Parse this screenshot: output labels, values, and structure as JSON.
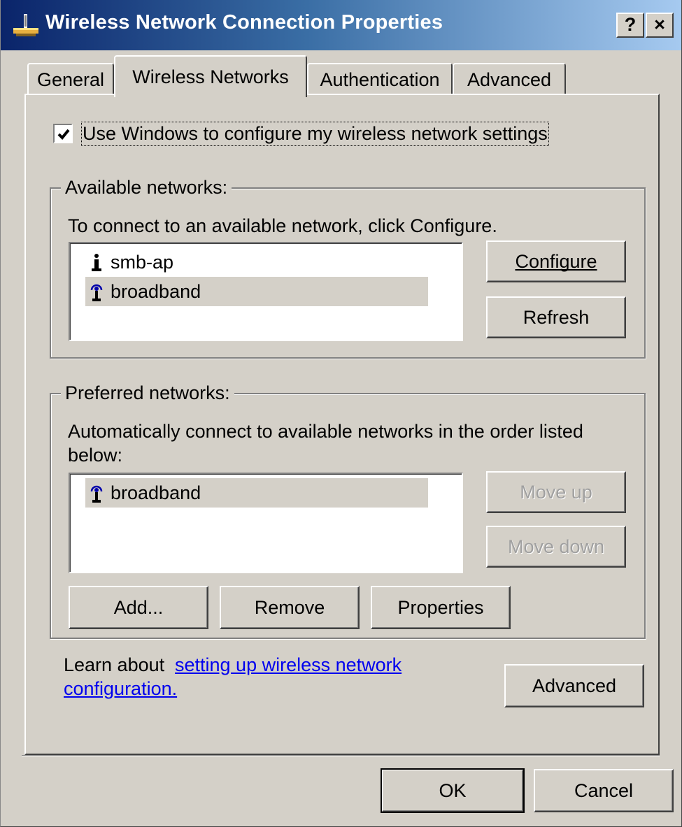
{
  "window": {
    "title": "Wireless Network Connection Properties",
    "help_label": "?",
    "close_label": "×"
  },
  "tabs": [
    {
      "label": "General",
      "active": false
    },
    {
      "label": "Wireless Networks",
      "active": true
    },
    {
      "label": "Authentication",
      "active": false
    },
    {
      "label": "Advanced",
      "active": false
    }
  ],
  "use_windows": {
    "label": "Use Windows to configure my wireless network settings",
    "checked": true
  },
  "available": {
    "legend": "Available networks:",
    "description": "To connect to an available network, click Configure.",
    "networks": [
      {
        "name": "smb-ap",
        "icon": "access-point-icon"
      },
      {
        "name": "broadband",
        "icon": "wireless-antenna-icon"
      }
    ],
    "configure_label": "Configure",
    "refresh_label": "Refresh"
  },
  "preferred": {
    "legend": "Preferred networks:",
    "description_line1": "Automatically connect to available networks in the order listed",
    "description_line2": "below:",
    "networks": [
      {
        "name": "broadband",
        "icon": "wireless-antenna-icon"
      }
    ],
    "move_up_label": "Move up",
    "move_down_label": "Move down",
    "add_label": "Add...",
    "remove_label": "Remove",
    "properties_label": "Properties"
  },
  "learn": {
    "prefix": "Learn about",
    "link_line1": "setting up wireless network",
    "link_line2": "configuration."
  },
  "advanced_button_label": "Advanced",
  "ok_label": "OK",
  "cancel_label": "Cancel"
}
